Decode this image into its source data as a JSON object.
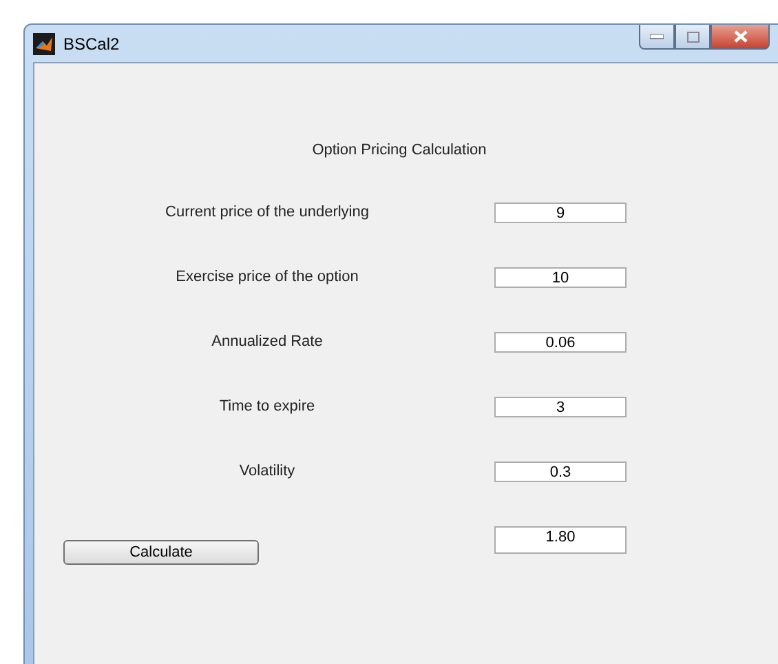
{
  "window": {
    "title": "BSCal2"
  },
  "heading": "Option Pricing Calculation",
  "fields": [
    {
      "label": "Current price of the underlying",
      "value": "9"
    },
    {
      "label": "Exercise price of the option",
      "value": "10"
    },
    {
      "label": "Annualized Rate",
      "value": "0.06"
    },
    {
      "label": "Time to expire",
      "value": "3"
    },
    {
      "label": "Volatility",
      "value": "0.3"
    }
  ],
  "calculate_button": "Calculate",
  "result": "1.80"
}
